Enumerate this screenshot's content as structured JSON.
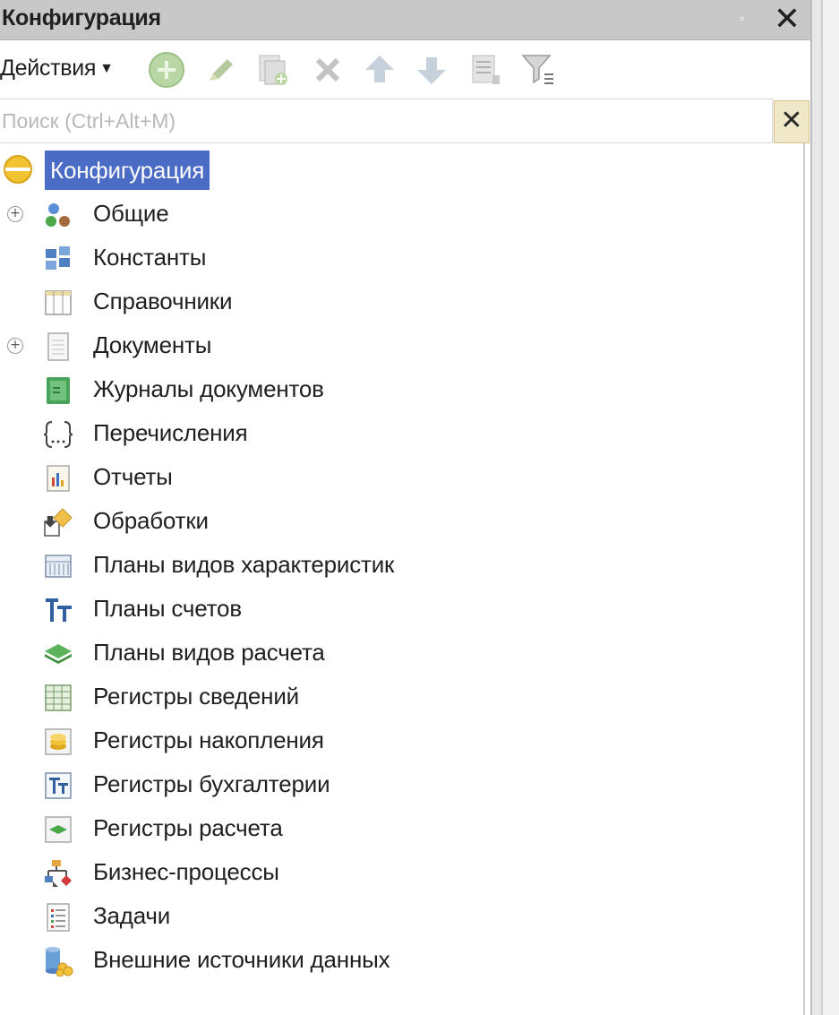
{
  "window": {
    "title": "Конфигурация",
    "pin_glyph": "▫",
    "close_glyph": "✕"
  },
  "toolbar": {
    "actions_label": "Действия",
    "actions_caret": "▼",
    "icons": [
      "add-icon",
      "edit-icon",
      "copy-icon",
      "delete-icon",
      "move-up-icon",
      "move-down-icon",
      "sort-icon",
      "filter-icon"
    ]
  },
  "search": {
    "placeholder": "Поиск (Ctrl+Alt+M)",
    "value": "",
    "clear_glyph": "✕"
  },
  "tree": {
    "root": {
      "label": "Конфигурация",
      "icon": "configuration-icon"
    },
    "items": [
      {
        "label": "Общие",
        "icon": "common-icon",
        "expandable": true
      },
      {
        "label": "Константы",
        "icon": "constants-icon",
        "expandable": false
      },
      {
        "label": "Справочники",
        "icon": "catalogs-icon",
        "expandable": false
      },
      {
        "label": "Документы",
        "icon": "documents-icon",
        "expandable": true
      },
      {
        "label": "Журналы документов",
        "icon": "document-journals-icon",
        "expandable": false
      },
      {
        "label": "Перечисления",
        "icon": "enumerations-icon",
        "expandable": false
      },
      {
        "label": "Отчеты",
        "icon": "reports-icon",
        "expandable": false
      },
      {
        "label": "Обработки",
        "icon": "data-processors-icon",
        "expandable": false
      },
      {
        "label": "Планы видов характеристик",
        "icon": "chart-of-characteristic-types-icon",
        "expandable": false
      },
      {
        "label": "Планы счетов",
        "icon": "chart-of-accounts-icon",
        "expandable": false
      },
      {
        "label": "Планы видов расчета",
        "icon": "chart-of-calculation-types-icon",
        "expandable": false
      },
      {
        "label": "Регистры сведений",
        "icon": "information-registers-icon",
        "expandable": false
      },
      {
        "label": "Регистры накопления",
        "icon": "accumulation-registers-icon",
        "expandable": false
      },
      {
        "label": "Регистры бухгалтерии",
        "icon": "accounting-registers-icon",
        "expandable": false
      },
      {
        "label": "Регистры расчета",
        "icon": "calculation-registers-icon",
        "expandable": false
      },
      {
        "label": "Бизнес-процессы",
        "icon": "business-processes-icon",
        "expandable": false
      },
      {
        "label": "Задачи",
        "icon": "tasks-icon",
        "expandable": false
      },
      {
        "label": "Внешние источники данных",
        "icon": "external-data-sources-icon",
        "expandable": false
      }
    ],
    "expander_glyph": "+"
  },
  "colors": {
    "selection": "#4b6cc4",
    "titlebar": "#c8c8c8",
    "clear_button": "#f0e8c8"
  }
}
